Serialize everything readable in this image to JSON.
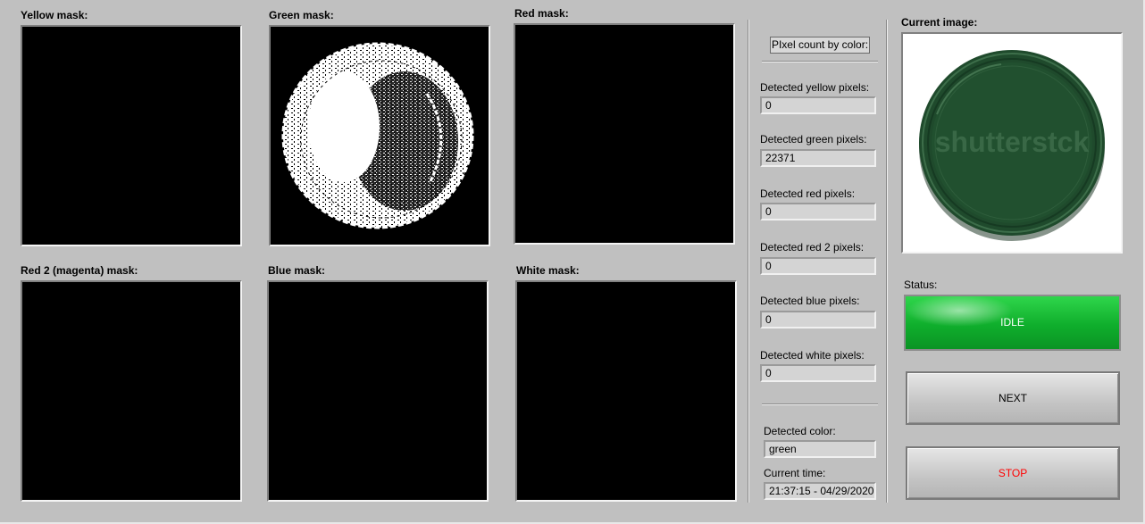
{
  "masks": {
    "yellow_label": "Yellow mask:",
    "green_label": "Green mask:",
    "red_label": "Red mask:",
    "red2_label": "Red 2 (magenta) mask:",
    "blue_label": "Blue mask:",
    "white_label": "White mask:"
  },
  "pixel_count": {
    "header_button": "PIxel count by color:",
    "yellow_label": "Detected yellow pixels:",
    "yellow_value": "0",
    "green_label": "Detected green pixels:",
    "green_value": "22371",
    "red_label": "Detected red pixels:",
    "red_value": "0",
    "red2_label": "Detected red 2 pixels:",
    "red2_value": "0",
    "blue_label": "Detected blue pixels:",
    "blue_value": "0",
    "white_label": "Detected white pixels:",
    "white_value": "0"
  },
  "detected": {
    "color_label": "Detected color:",
    "color_value": "green",
    "time_label": "Current time:",
    "time_value": "21:37:15 - 04/29/2020"
  },
  "right_panel": {
    "image_label": "Current image:",
    "watermark": "shutterstck",
    "status_label": "Status:",
    "status_value": "IDLE",
    "next_label": "NEXT",
    "stop_label": "STOP"
  },
  "colors": {
    "status_green": "#12b52f",
    "stop_text": "#ff0000",
    "lid_green": "#1f4a2c"
  }
}
